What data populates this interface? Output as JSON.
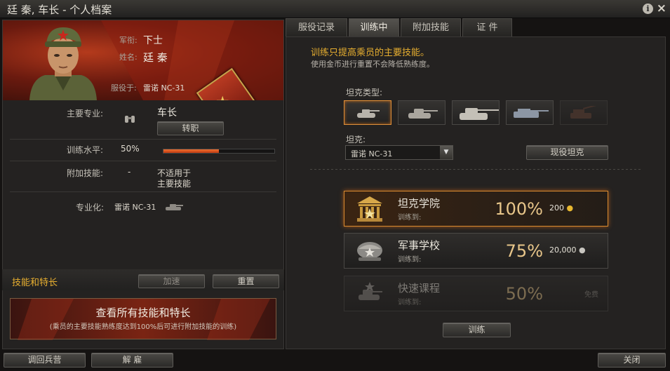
{
  "window": {
    "title": "廷 秦, 车长 - 个人档案",
    "help_icon": "i",
    "close_icon": "×"
  },
  "profile": {
    "rank_label": "军衔:",
    "rank_value": "下士",
    "name_label": "姓名:",
    "name_value": "廷 秦",
    "served_label": "服役于:",
    "served_value": "雷诺 NC-31"
  },
  "details": {
    "specialty_label": "主要专业:",
    "specialty_icon": "binoculars-icon",
    "specialty_value": "车长",
    "retrain_button": "转职",
    "training_label": "训练水平:",
    "training_value": "50%",
    "training_progress": 0.5,
    "extra_skills_label": "附加技能:",
    "extra_skills_value": "-",
    "extra_skills_note_1": "不适用于",
    "extra_skills_note_2": "主要技能",
    "specialization_label": "专业化:",
    "specialization_value": "雷诺 NC-31"
  },
  "skills": {
    "title": "技能和特长",
    "speedup_button": "加速",
    "reset_button": "重置",
    "view_all_title": "查看所有技能和特长",
    "view_all_subtitle": "(乘员的主要技能熟练度达到100%后可进行附加技能的训练)"
  },
  "footer": {
    "barracks_button": "调回兵营",
    "dismiss_button": "解 雇",
    "close_button": "关闭"
  },
  "tabs": [
    "服役记录",
    "训练中",
    "附加技能",
    "证 件"
  ],
  "active_tab": 1,
  "training": {
    "info_title": "训练只提高乘员的主要技能。",
    "info_subtitle": "使用金币进行重置不会降低熟练度。",
    "tank_type_label": "坦克类型:",
    "tank_label": "坦克:",
    "tank_select_value": "雷诺 NC-31",
    "current_tank_button": "现役坦克",
    "train_button": "训练",
    "courses": [
      {
        "name": "坦克学院",
        "sub": "训练到:",
        "percent": "100%",
        "cost": "200",
        "currency_icon": "gold-icon"
      },
      {
        "name": "军事学校",
        "sub": "训练到:",
        "percent": "75%",
        "cost": "20,000",
        "currency_icon": "silver-icon"
      },
      {
        "name": "快速课程",
        "sub": "训练到:",
        "percent": "50%",
        "cost": "免费",
        "currency_icon": ""
      }
    ]
  },
  "colors": {
    "accent": "#e6ae30",
    "selected_border": "#d98a30",
    "progress": "#e05a20"
  }
}
